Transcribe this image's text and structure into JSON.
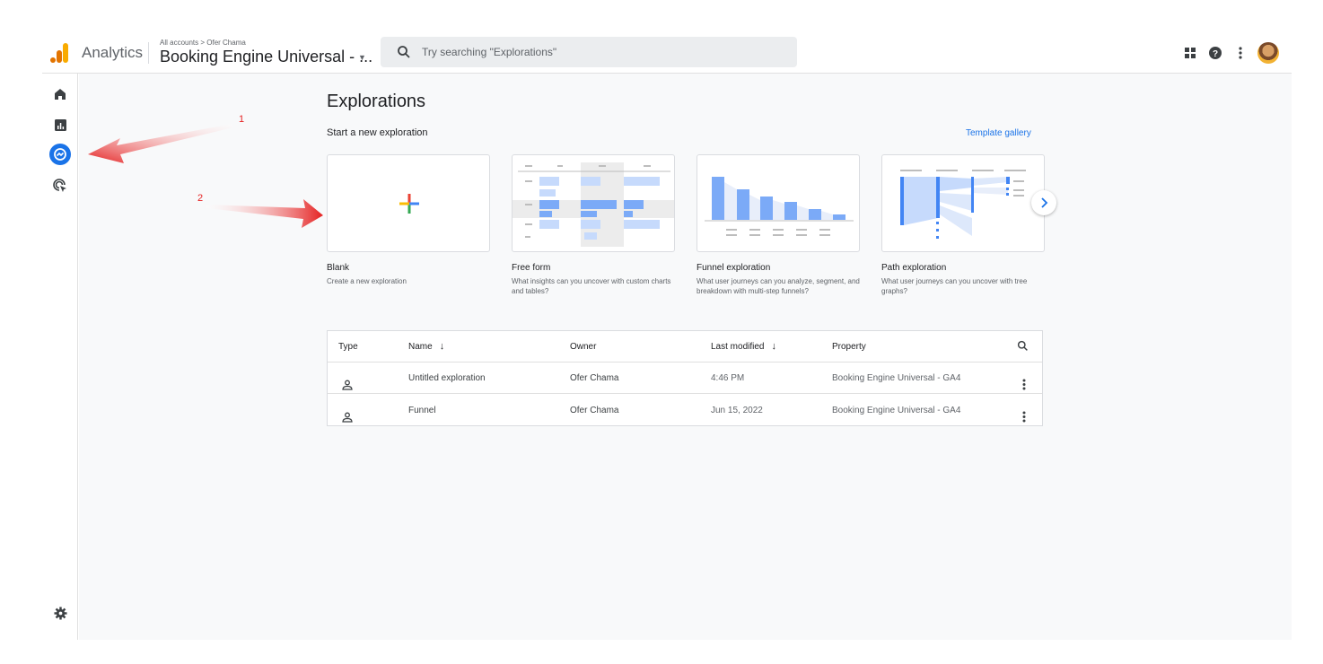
{
  "header": {
    "app_name": "Analytics",
    "breadcrumb": "All accounts > Ofer Chama",
    "property_name": "Booking Engine Universal - ...",
    "search_placeholder": "Try searching \"Explorations\""
  },
  "page": {
    "title": "Explorations",
    "section_label": "Start a new exploration",
    "template_link": "Template gallery"
  },
  "templates": [
    {
      "title": "Blank",
      "description": "Create a new exploration"
    },
    {
      "title": "Free form",
      "description": "What insights can you uncover with custom charts and tables?"
    },
    {
      "title": "Funnel exploration",
      "description": "What user journeys can you analyze, segment, and breakdown with multi-step funnels?"
    },
    {
      "title": "Path exploration",
      "description": "What user journeys can you uncover with tree graphs?"
    }
  ],
  "table": {
    "columns": {
      "type": "Type",
      "name": "Name",
      "owner": "Owner",
      "modified": "Last modified",
      "property": "Property"
    },
    "rows": [
      {
        "name": "Untitled exploration",
        "owner": "Ofer Chama",
        "modified": "4:46 PM",
        "property": "Booking Engine Universal - GA4"
      },
      {
        "name": "Funnel",
        "owner": "Ofer Chama",
        "modified": "Jun 15, 2022",
        "property": "Booking Engine Universal - GA4"
      }
    ]
  },
  "annotations": {
    "arrow1": "1",
    "arrow2": "2"
  },
  "colors": {
    "accent": "#1a73e8",
    "annotation": "#e52222",
    "logo_orange": "#f9ab00",
    "logo_dark": "#e37400"
  }
}
